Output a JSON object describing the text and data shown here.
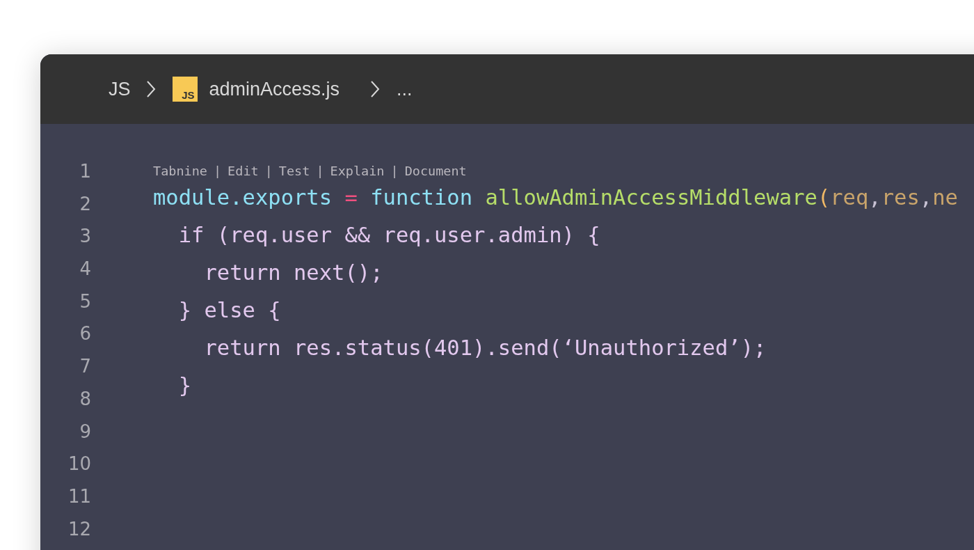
{
  "breadcrumb": [
    {
      "kind": "text",
      "label": "JS"
    },
    {
      "kind": "file",
      "badge": "JS",
      "label": "adminAccess.js"
    },
    {
      "kind": "text",
      "label": "..."
    }
  ],
  "line_numbers": [
    "1",
    "2",
    "3",
    "4",
    "5",
    "6",
    "7",
    "8",
    "9",
    "10",
    "11",
    "12"
  ],
  "codelens": {
    "separator": "|",
    "items": [
      "Tabnine",
      "Edit",
      "Test",
      "Explain",
      "Document"
    ]
  },
  "code_lines": [
    {
      "tokens": [
        {
          "kind": "keyword",
          "text": "module.exports"
        },
        {
          "kind": "operator",
          "text": " = "
        },
        {
          "kind": "keyword",
          "text": "function "
        },
        {
          "kind": "function",
          "text": "allowAdminAccessMiddleware"
        },
        {
          "kind": "paren",
          "text": "("
        },
        {
          "kind": "param",
          "text": "req"
        },
        {
          "kind": "comma",
          "text": ","
        },
        {
          "kind": "param",
          "text": "res"
        },
        {
          "kind": "comma",
          "text": ","
        },
        {
          "kind": "param",
          "text": "ne"
        }
      ]
    },
    {
      "tokens": [
        {
          "kind": "plain",
          "text": "  if (req.user && req.user.admin) {"
        }
      ]
    },
    {
      "tokens": [
        {
          "kind": "plain",
          "text": "    return next();"
        }
      ]
    },
    {
      "tokens": [
        {
          "kind": "plain",
          "text": "  } else {"
        }
      ]
    },
    {
      "tokens": [
        {
          "kind": "plain",
          "text": "    return res.status(401).send(‘Unauthorized’);"
        }
      ]
    },
    {
      "tokens": [
        {
          "kind": "plain",
          "text": "  }"
        }
      ]
    }
  ]
}
